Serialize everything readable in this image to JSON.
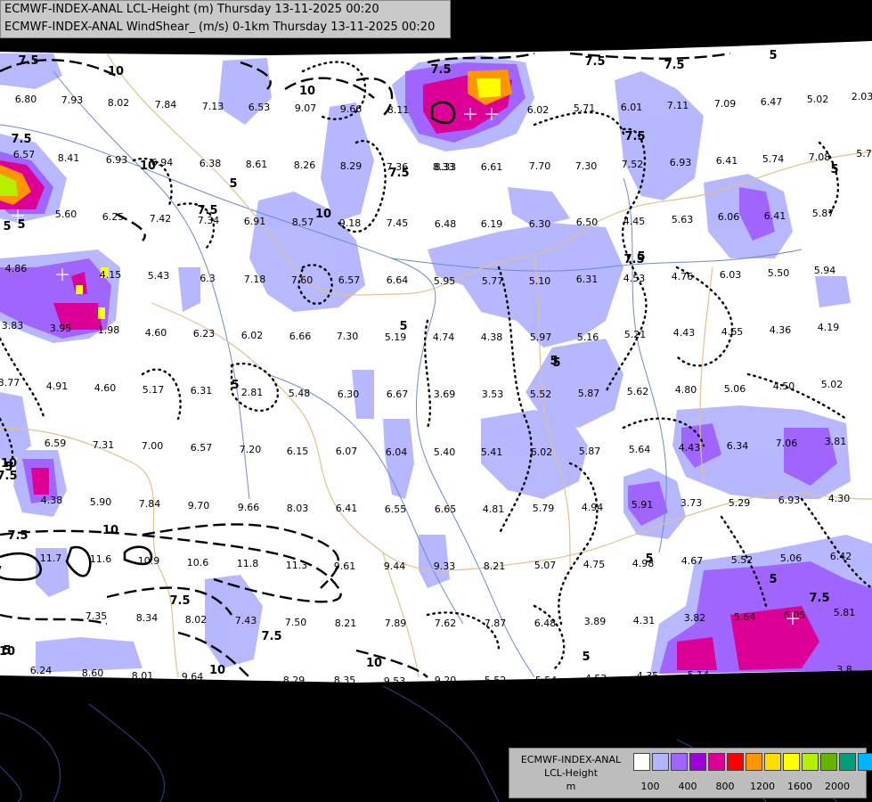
{
  "header": {
    "line1": "ECMWF-INDEX-ANAL LCL-Height (m) Thursday 13-11-2025 00:20",
    "line2": "ECMWF-INDEX-ANAL WindShear_ (m/s) 0-1km Thursday 13-11-2025 00:20"
  },
  "legend": {
    "title_line1": "ECMWF-INDEX-ANAL",
    "title_line2": "LCL-Height",
    "title_line3": "m",
    "colors": [
      "#ffffff",
      "#b4b4ff",
      "#a064ff",
      "#a000dc",
      "#dc0096",
      "#ff0000",
      "#ff9600",
      "#ffdc00",
      "#ffff00",
      "#b4f000",
      "#64b400",
      "#00a078",
      "#00b4ff"
    ],
    "ticks": [
      "100",
      "400",
      "800",
      "1200",
      "1600",
      "2000"
    ]
  },
  "colors": {
    "background": "#000000",
    "land": "#ffffff",
    "border": "#e2c08c",
    "river": "#6c8cc8",
    "coast": "#2a3a7a"
  },
  "contour_labels": [
    "7.5",
    "10",
    "7.5",
    "7.5",
    "7.5",
    "5",
    "7.5",
    "10",
    "10",
    "7.5",
    "5",
    "7.5",
    "10",
    "7.5",
    "5",
    "5",
    "5",
    "5",
    "5",
    "5",
    "5",
    "10",
    "10",
    "7.5",
    "7.5",
    "10",
    "7.5",
    "5",
    "5",
    "7.5",
    "5",
    "7.5",
    "10",
    "5",
    "10",
    "5",
    "7.5",
    "5"
  ],
  "values": [
    "6.80",
    "7.93",
    "8.02",
    "7.84",
    "7.13",
    "6.53",
    "9.07",
    "9.66",
    "8.11",
    "8.33",
    "6.02",
    "5.71",
    "6.01",
    "7.11",
    "7.09",
    "6.47",
    "5.02",
    "2.03",
    "6.57",
    "8.41",
    "6.93",
    "6.94",
    "6.38",
    "8.61",
    "8.26",
    "8.29",
    "7.36",
    "8.33",
    "6.61",
    "7.70",
    "7.30",
    "7.52",
    "6.93",
    "6.41",
    "5.74",
    "7.08",
    "5.7",
    "5.60",
    "6.25",
    "7.42",
    "7.34",
    "6.91",
    "8.57",
    "9.18",
    "7.45",
    "6.48",
    "6.19",
    "6.30",
    "6.50",
    "4.45",
    "5.63",
    "6.06",
    "6.41",
    "5.87",
    "4.86",
    "4.15",
    "5.43",
    "6.3",
    "7.18",
    "7.60",
    "6.57",
    "6.64",
    "5.95",
    "5.77",
    "5.10",
    "6.31",
    "4.53",
    "4.76",
    "6.03",
    "5.50",
    "5.94",
    "3.83",
    "3.95",
    "1.98",
    "4.60",
    "6.23",
    "6.02",
    "6.66",
    "7.30",
    "5.19",
    "4.74",
    "4.38",
    "5.97",
    "5.16",
    "5.21",
    "4.43",
    "4.65",
    "4.36",
    "4.19",
    "3.77",
    "4.91",
    "4.60",
    "5.17",
    "6.31",
    "2.81",
    "5.48",
    "6.30",
    "6.67",
    "3.69",
    "3.53",
    "5.52",
    "5.87",
    "5.62",
    "4.80",
    "5.06",
    "4.50",
    "5.02",
    "6.59",
    "7.31",
    "7.00",
    "6.57",
    "7.20",
    "6.15",
    "6.07",
    "6.04",
    "5.40",
    "5.41",
    "6.02",
    "5.87",
    "5.64",
    "4.43",
    "6.34",
    "7.06",
    "3.81",
    "4.38",
    "5.90",
    "7.84",
    "9.70",
    "9.66",
    "8.03",
    "6.41",
    "6.55",
    "6.65",
    "4.81",
    "5.79",
    "4.94",
    "5.91",
    "3.73",
    "5.29",
    "6.93",
    "4.30",
    "11.7",
    "11.6",
    "10.9",
    "10.6",
    "11.8",
    "11.3",
    "9.61",
    "9.44",
    "9.33",
    "8.21",
    "5.07",
    "4.75",
    "4.98",
    "4.67",
    "5.52",
    "5.06",
    "6.42",
    "7.35",
    "8.34",
    "8.02",
    "7.43",
    "7.50",
    "8.21",
    "7.89",
    "7.62",
    "7.87",
    "6.48",
    "3.89",
    "4.31",
    "3.82",
    "5.64",
    "6.05",
    "5.81",
    "6.24",
    "8.60",
    "8.01",
    "9.64",
    "8.29",
    "8.35",
    "9.53",
    "9.20",
    "5.52",
    "5.54",
    "4.53",
    "4.35",
    "5.14",
    "3.8"
  ]
}
